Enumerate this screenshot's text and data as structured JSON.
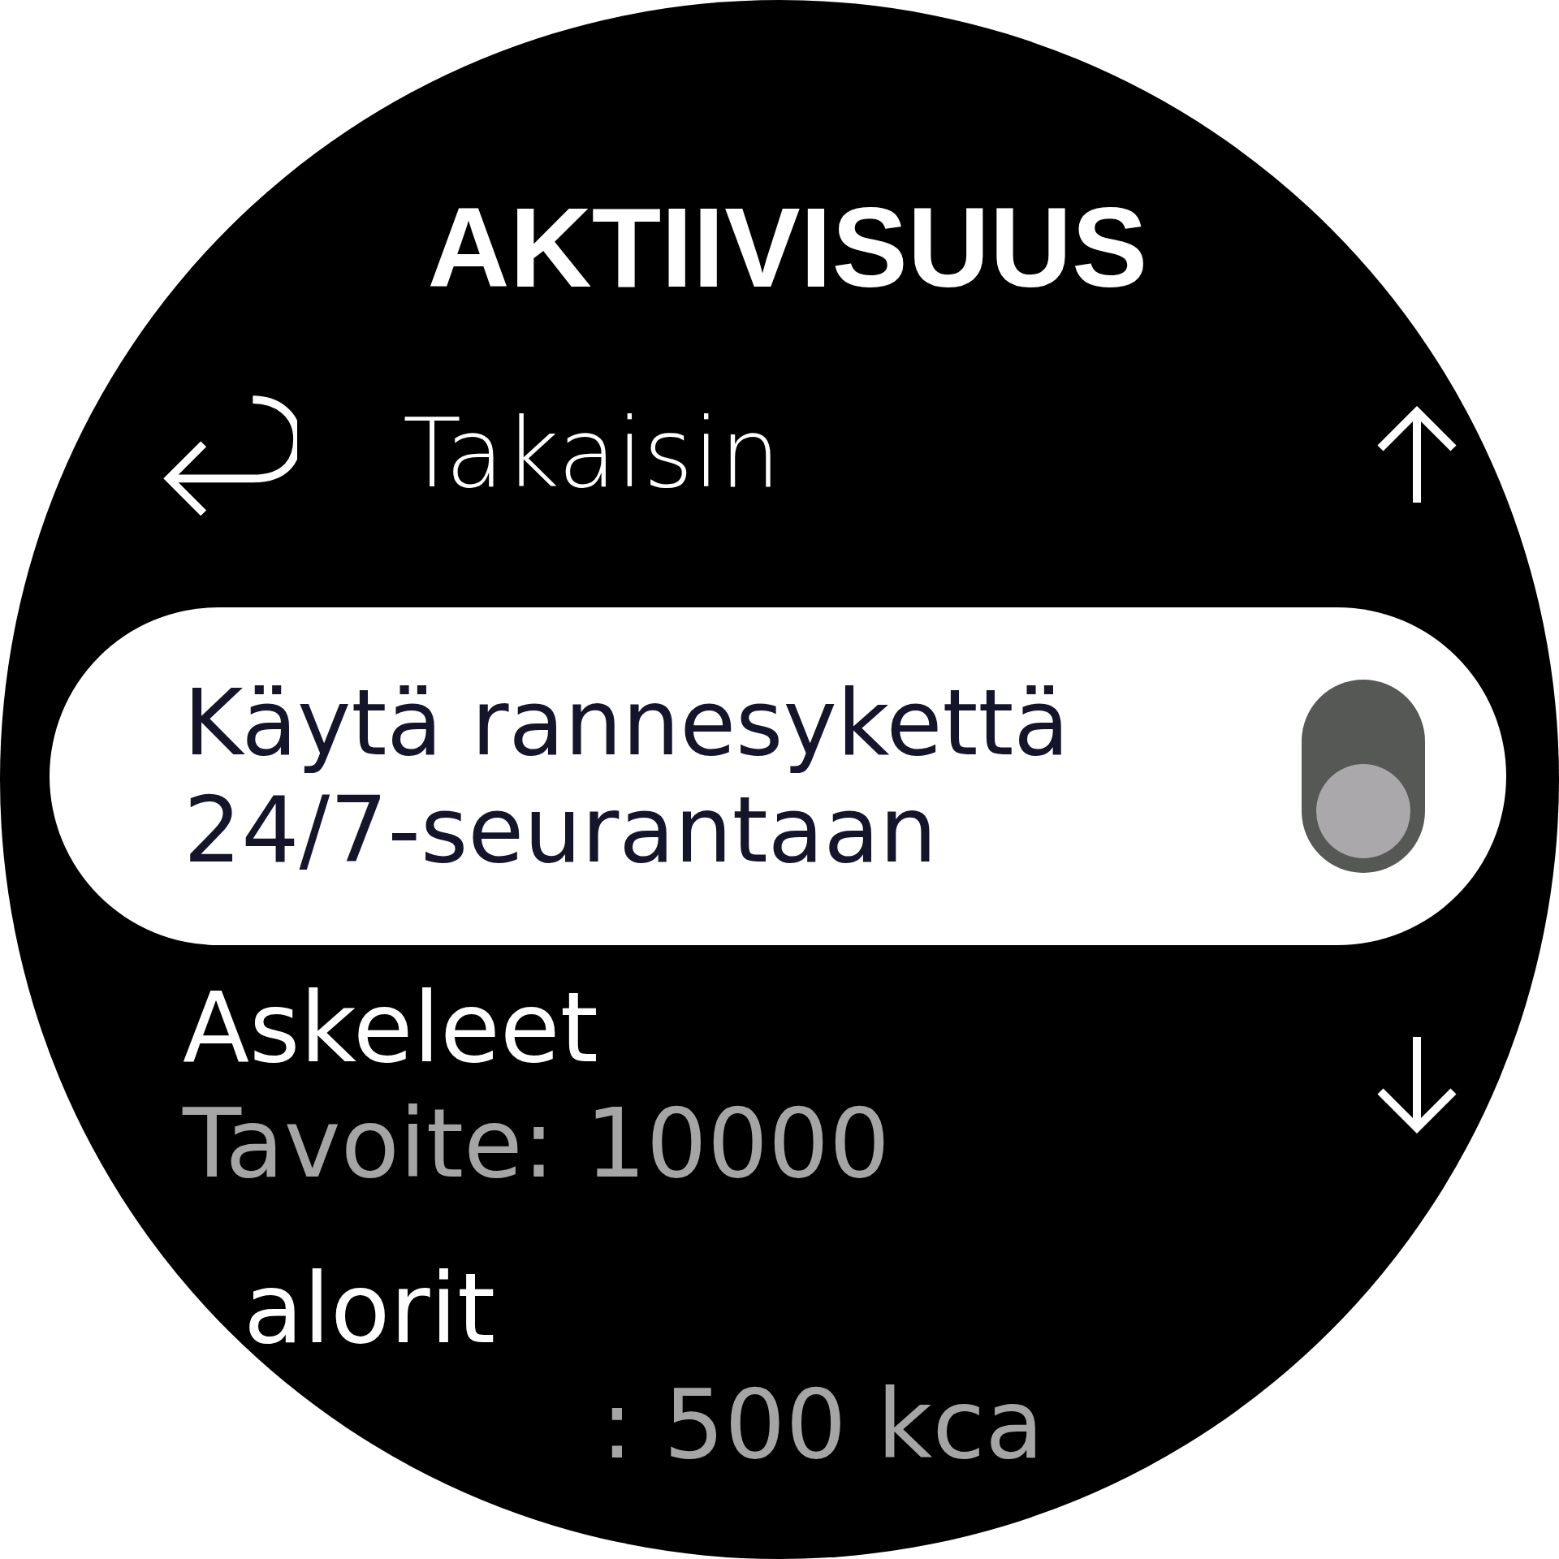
{
  "title": "AKTIIVISUUS",
  "back": {
    "label": "Takaisin"
  },
  "items": [
    {
      "kind": "toggle",
      "label": "Käytä rannesykettä 24/7-seurantaan",
      "on": false,
      "selected": true
    },
    {
      "kind": "goal",
      "label": "Askeleet",
      "value": "Tavoite: 10000",
      "selected": false
    },
    {
      "kind": "goal",
      "label": "alorit",
      "value": ": 500 kca",
      "selected": false
    }
  ]
}
